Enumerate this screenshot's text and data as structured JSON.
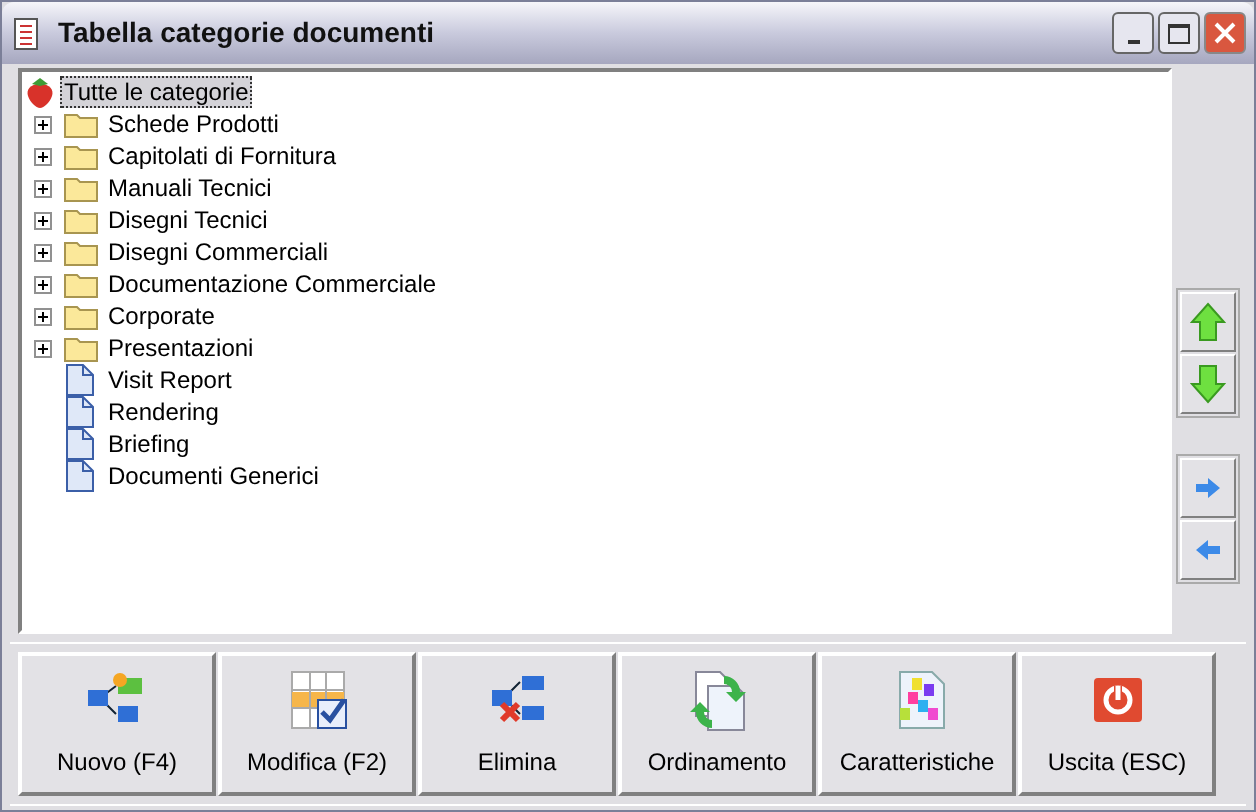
{
  "window": {
    "title": "Tabella categorie documenti"
  },
  "tree": {
    "root": {
      "label": "Tutte le categorie",
      "selected": true
    },
    "children": [
      {
        "label": "Schede Prodotti",
        "kind": "folder",
        "expanded": false,
        "selected": false
      },
      {
        "label": "Capitolati di Fornitura",
        "kind": "folder",
        "expanded": false,
        "selected": false
      },
      {
        "label": "Manuali Tecnici",
        "kind": "folder",
        "expanded": false,
        "selected": false
      },
      {
        "label": "Disegni Tecnici",
        "kind": "folder",
        "expanded": false,
        "selected": false
      },
      {
        "label": "Disegni Commerciali",
        "kind": "folder",
        "expanded": false,
        "selected": false
      },
      {
        "label": "Documentazione Commerciale",
        "kind": "folder",
        "expanded": false,
        "selected": false
      },
      {
        "label": "Corporate",
        "kind": "folder",
        "expanded": false,
        "selected": false
      },
      {
        "label": "Presentazioni",
        "kind": "folder",
        "expanded": false,
        "selected": false
      },
      {
        "label": "Visit Report",
        "kind": "document",
        "selected": false
      },
      {
        "label": "Rendering",
        "kind": "document",
        "selected": false
      },
      {
        "label": "Briefing",
        "kind": "document",
        "selected": false
      },
      {
        "label": "Documenti Generici",
        "kind": "document",
        "selected": false
      }
    ]
  },
  "toolbar": [
    {
      "label": "Nuovo (F4)",
      "kind": "new"
    },
    {
      "label": "Modifica (F2)",
      "kind": "edit"
    },
    {
      "label": "Elimina",
      "kind": "delete"
    },
    {
      "label": "Ordinamento",
      "kind": "sort"
    },
    {
      "label": "Caratteristiche",
      "kind": "properties"
    },
    {
      "label": "Uscita (ESC)",
      "kind": "exit"
    }
  ]
}
